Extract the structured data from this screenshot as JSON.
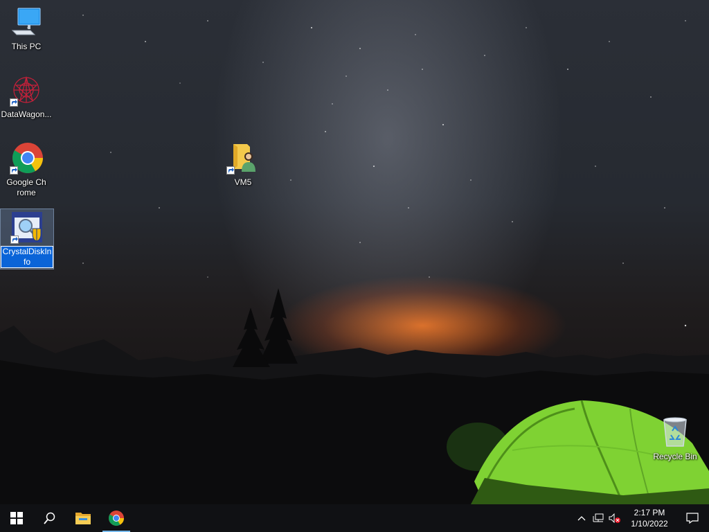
{
  "desktop": {
    "icons": [
      {
        "label": "This PC"
      },
      {
        "label": "DataWagon..."
      },
      {
        "label": "Google Chrome"
      },
      {
        "label": "CrystalDiskInfo"
      },
      {
        "label": "VM5"
      },
      {
        "label": "Recycle Bin"
      }
    ]
  },
  "taskbar": {
    "pinned": [
      "start-icon",
      "search-icon",
      "file-explorer-icon",
      "chrome-icon"
    ],
    "tray_icons": [
      "chevron-up-icon",
      "network-icon",
      "volume-muted-icon"
    ],
    "clock": {
      "time": "2:17 PM",
      "date": "1/10/2022"
    },
    "accent": "#76b9ed"
  },
  "colors": {
    "selection": "#0a64d8",
    "taskbar_bg": "#101114",
    "tent": "#8fe03a"
  }
}
